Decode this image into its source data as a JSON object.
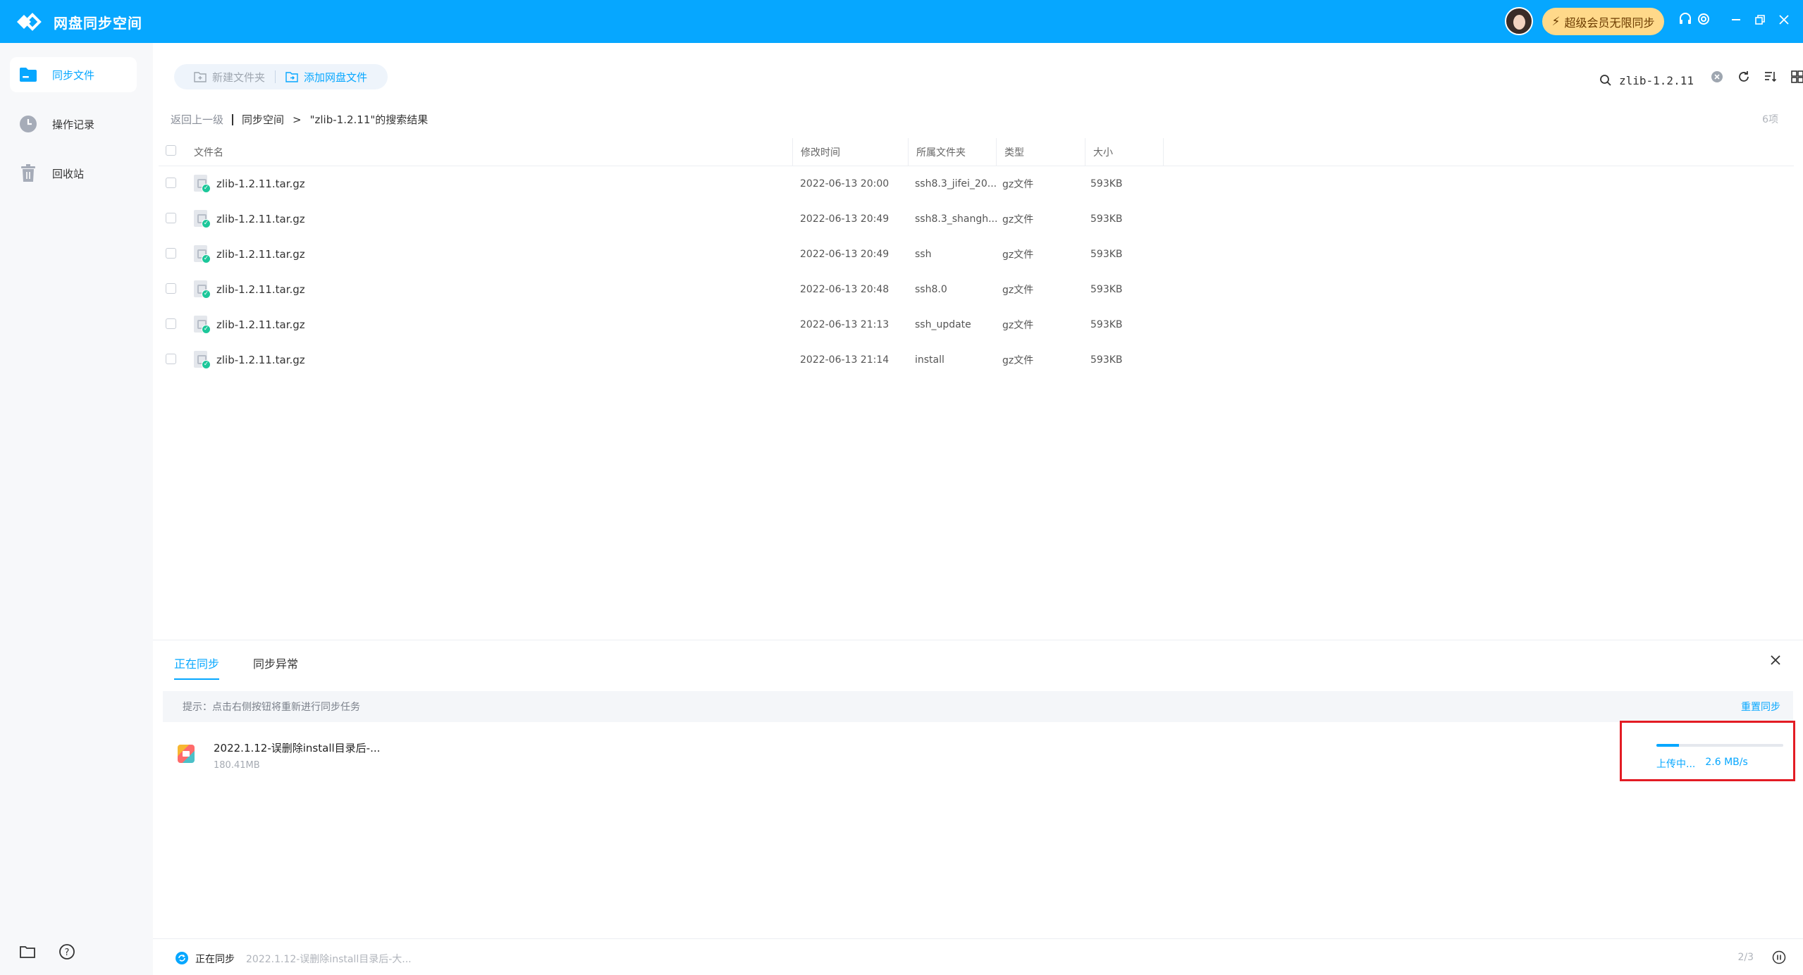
{
  "app": {
    "title": "网盘同步空间",
    "vip_label": "超级会员无限同步",
    "accent": "#06a7ff"
  },
  "sidebar": {
    "items": [
      {
        "label": "同步文件",
        "icon": "folder-icon",
        "active": true
      },
      {
        "label": "操作记录",
        "icon": "clock-icon",
        "active": false
      },
      {
        "label": "回收站",
        "icon": "trash-icon",
        "active": false
      }
    ],
    "bottom_icons": [
      "folder-outline-icon",
      "help-icon"
    ]
  },
  "toolbar": {
    "new_folder": "新建文件夹",
    "add_netdisk_file": "添加网盘文件",
    "search_value": "zlib-1.2.11"
  },
  "breadcrumb": {
    "back": "返回上一级",
    "root": "同步空间",
    "separator": ">",
    "current": "\"zlib-1.2.11\"的搜索结果",
    "count": "6项"
  },
  "table": {
    "headers": {
      "name": "文件名",
      "time": "修改时间",
      "folder": "所属文件夹",
      "type": "类型",
      "size": "大小"
    },
    "rows": [
      {
        "name": "zlib-1.2.11.tar.gz",
        "time": "2022-06-13 20:00",
        "folder": "ssh8.3_jifei_20...",
        "type": "gz文件",
        "size": "593KB"
      },
      {
        "name": "zlib-1.2.11.tar.gz",
        "time": "2022-06-13 20:49",
        "folder": "ssh8.3_shangh...",
        "type": "gz文件",
        "size": "593KB"
      },
      {
        "name": "zlib-1.2.11.tar.gz",
        "time": "2022-06-13 20:49",
        "folder": "ssh",
        "type": "gz文件",
        "size": "593KB"
      },
      {
        "name": "zlib-1.2.11.tar.gz",
        "time": "2022-06-13 20:48",
        "folder": "ssh8.0",
        "type": "gz文件",
        "size": "593KB"
      },
      {
        "name": "zlib-1.2.11.tar.gz",
        "time": "2022-06-13 21:13",
        "folder": "ssh_update",
        "type": "gz文件",
        "size": "593KB"
      },
      {
        "name": "zlib-1.2.11.tar.gz",
        "time": "2022-06-13 21:14",
        "folder": "install",
        "type": "gz文件",
        "size": "593KB"
      }
    ]
  },
  "sync_panel": {
    "tabs": [
      "正在同步",
      "同步异常"
    ],
    "hint": "提示：点击右侧按钮将重新进行同步任务",
    "retry": "重置同步",
    "task": {
      "name": "2022.1.12-误删除install目录后-...",
      "size": "180.41MB",
      "status": "上传中...",
      "speed": "2.6 MB/s",
      "progress": 0.18
    }
  },
  "footer": {
    "label": "正在同步",
    "current": "2022.1.12-误删除install目录后-大...",
    "page": "2/3"
  }
}
